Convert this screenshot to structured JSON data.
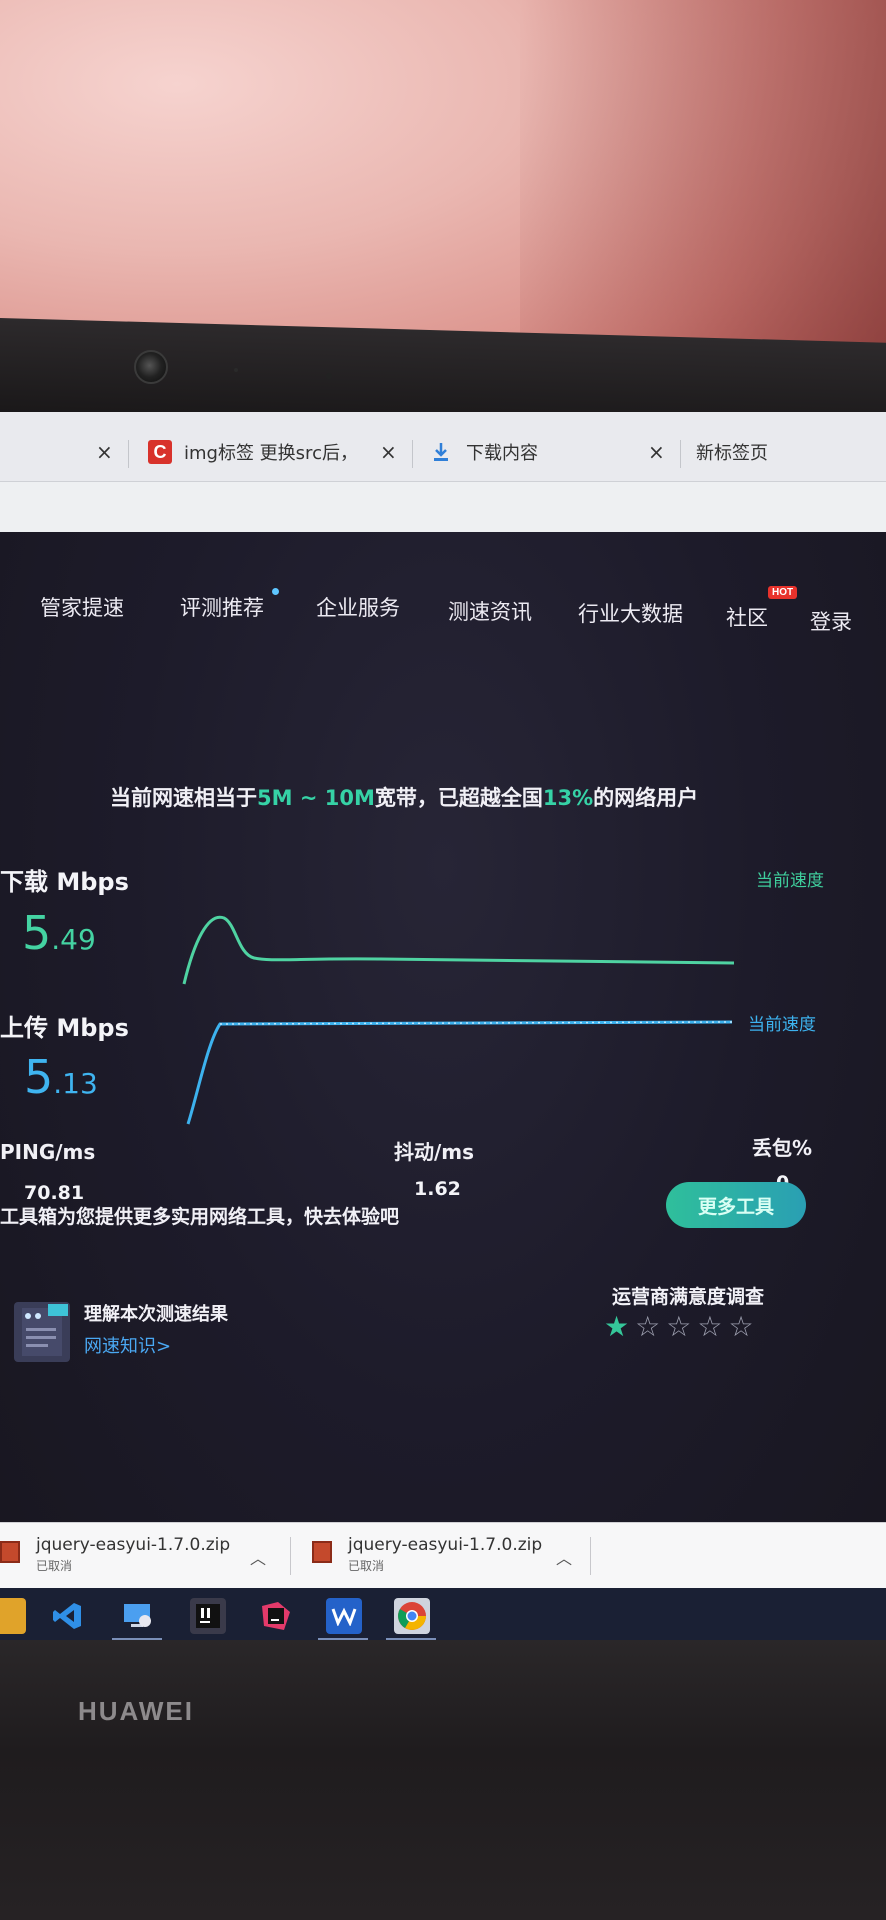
{
  "browser": {
    "tabs": [
      {
        "label": "",
        "close": "×"
      },
      {
        "label": "img标签 更换src后，",
        "close": "×",
        "icon": "csdn-icon"
      },
      {
        "label": "下载内容",
        "close": "×",
        "icon": "download-icon"
      },
      {
        "label": "新标签页"
      }
    ]
  },
  "nav": {
    "items": [
      "管家提速",
      "评测推荐",
      "企业服务",
      "测速资讯",
      "行业大数据",
      "社区",
      "登录"
    ],
    "hot_badge": "HOT"
  },
  "headline": {
    "prefix": "当前网速相当于",
    "range": "5M ~ 10M",
    "mid": "宽带，已超越全国",
    "percent": "13%",
    "suffix": "的网络用户"
  },
  "download": {
    "label": "下载 Mbps",
    "int": "5",
    "dec": ".49",
    "current_label": "当前速度"
  },
  "upload": {
    "label": "上传 Mbps",
    "int": "5",
    "dec": ".13",
    "current_label": "当前速度"
  },
  "stats": {
    "ping_label": "PING/ms",
    "ping_value": "70.81",
    "jitter_label": "抖动/ms",
    "jitter_value": "1.62",
    "loss_label": "丢包%",
    "loss_value": "0"
  },
  "tools": {
    "promo": "工具箱为您提供更多实用网络工具，快去体验吧",
    "button": "更多工具"
  },
  "knowledge": {
    "title": "理解本次测速结果",
    "link": "网速知识>"
  },
  "survey": {
    "title": "运营商满意度调查",
    "rating": 1,
    "max": 5
  },
  "downloads_bar": {
    "items": [
      {
        "name": "jquery-easyui-1.7.0.zip",
        "status": "已取消"
      },
      {
        "name": "jquery-easyui-1.7.0.zip",
        "status": "已取消"
      }
    ]
  },
  "laptop": {
    "brand": "HUAWEI"
  },
  "colors": {
    "accent_green": "#44d3a2",
    "accent_blue": "#3fb4f0",
    "page_bg": "#1d1b2a"
  }
}
